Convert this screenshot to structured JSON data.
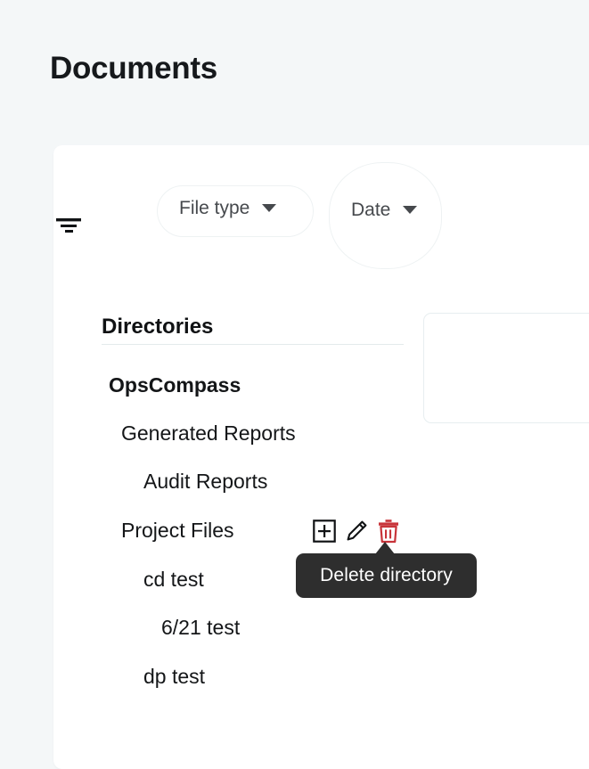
{
  "page": {
    "title": "Documents",
    "background_color": "#f4f7f8",
    "card_background": "#ffffff"
  },
  "toolbar": {
    "filter_icon": "filter-icon",
    "chips": [
      {
        "label": "File type",
        "caret": "chevron-down-icon"
      },
      {
        "label": "Date",
        "caret": "chevron-down-icon"
      }
    ]
  },
  "directories": {
    "heading": "Directories",
    "items": [
      {
        "label": "OpsCompass",
        "level": 0,
        "bold": true
      },
      {
        "label": "Generated Reports",
        "level": 1,
        "bold": false
      },
      {
        "label": "Audit Reports",
        "level": 2,
        "bold": false
      },
      {
        "label": "Project Files",
        "level": 1,
        "bold": false
      },
      {
        "label": "cd test",
        "level": 2,
        "bold": false
      },
      {
        "label": "6/21 test",
        "level": 3,
        "bold": false
      },
      {
        "label": "dp test",
        "level": 2,
        "bold": false
      }
    ]
  },
  "row_actions": {
    "add_label": "add-directory",
    "edit_label": "edit-directory",
    "delete_label": "delete-directory",
    "delete_color": "#c8343a"
  },
  "tooltip": {
    "text": "Delete directory",
    "background_color": "#2e2e2e",
    "text_color": "#ffffff"
  }
}
